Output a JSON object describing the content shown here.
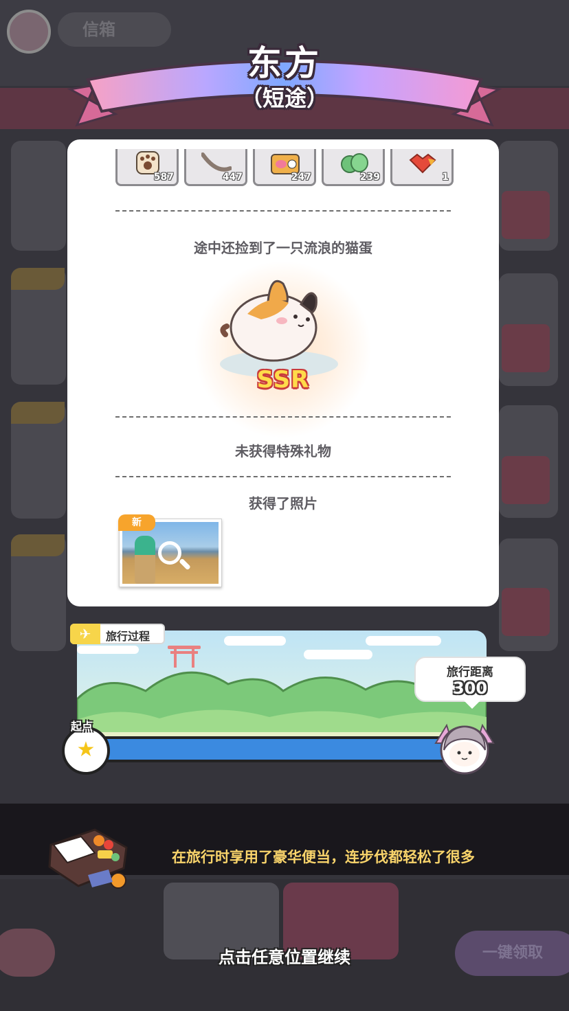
{
  "header": {
    "title": "东方",
    "subtitle": "（短途）"
  },
  "background": {
    "pill_text": "信箱",
    "bottom_right_button": "一键领取"
  },
  "rewards": {
    "items": [
      {
        "icon": "paw-cookie-icon",
        "count": "587"
      },
      {
        "icon": "fish-bone-icon",
        "count": "447"
      },
      {
        "icon": "canned-food-icon",
        "count": "247"
      },
      {
        "icon": "catnip-icon",
        "count": "239"
      },
      {
        "icon": "gem-heart-icon",
        "count": "1"
      }
    ]
  },
  "egg_section": {
    "text": "途中还捡到了一只流浪的猫蛋",
    "rarity": "SSR"
  },
  "gift_section": {
    "text": "未获得特殊礼物"
  },
  "photo_section": {
    "text": "获得了照片",
    "badge": "新"
  },
  "travel": {
    "tag": "旅行过程",
    "start_label": "起点",
    "distance_label": "旅行距离",
    "distance_value": "300"
  },
  "message": {
    "text": "在旅行时享用了豪华便当，连步伐都轻松了很多"
  },
  "footer": {
    "continue_text": "点击任意位置继续"
  },
  "colors": {
    "ribbon_gradient": [
      "#f7a1c4",
      "#b9a7ff",
      "#7fa8ff",
      "#c5a3ff",
      "#f59ad3"
    ],
    "message_text": "#f9d46b",
    "track_blue": "#3b8ae0",
    "ssr_fill": "#ffdb4a",
    "ssr_outline": "#c93b3b"
  }
}
